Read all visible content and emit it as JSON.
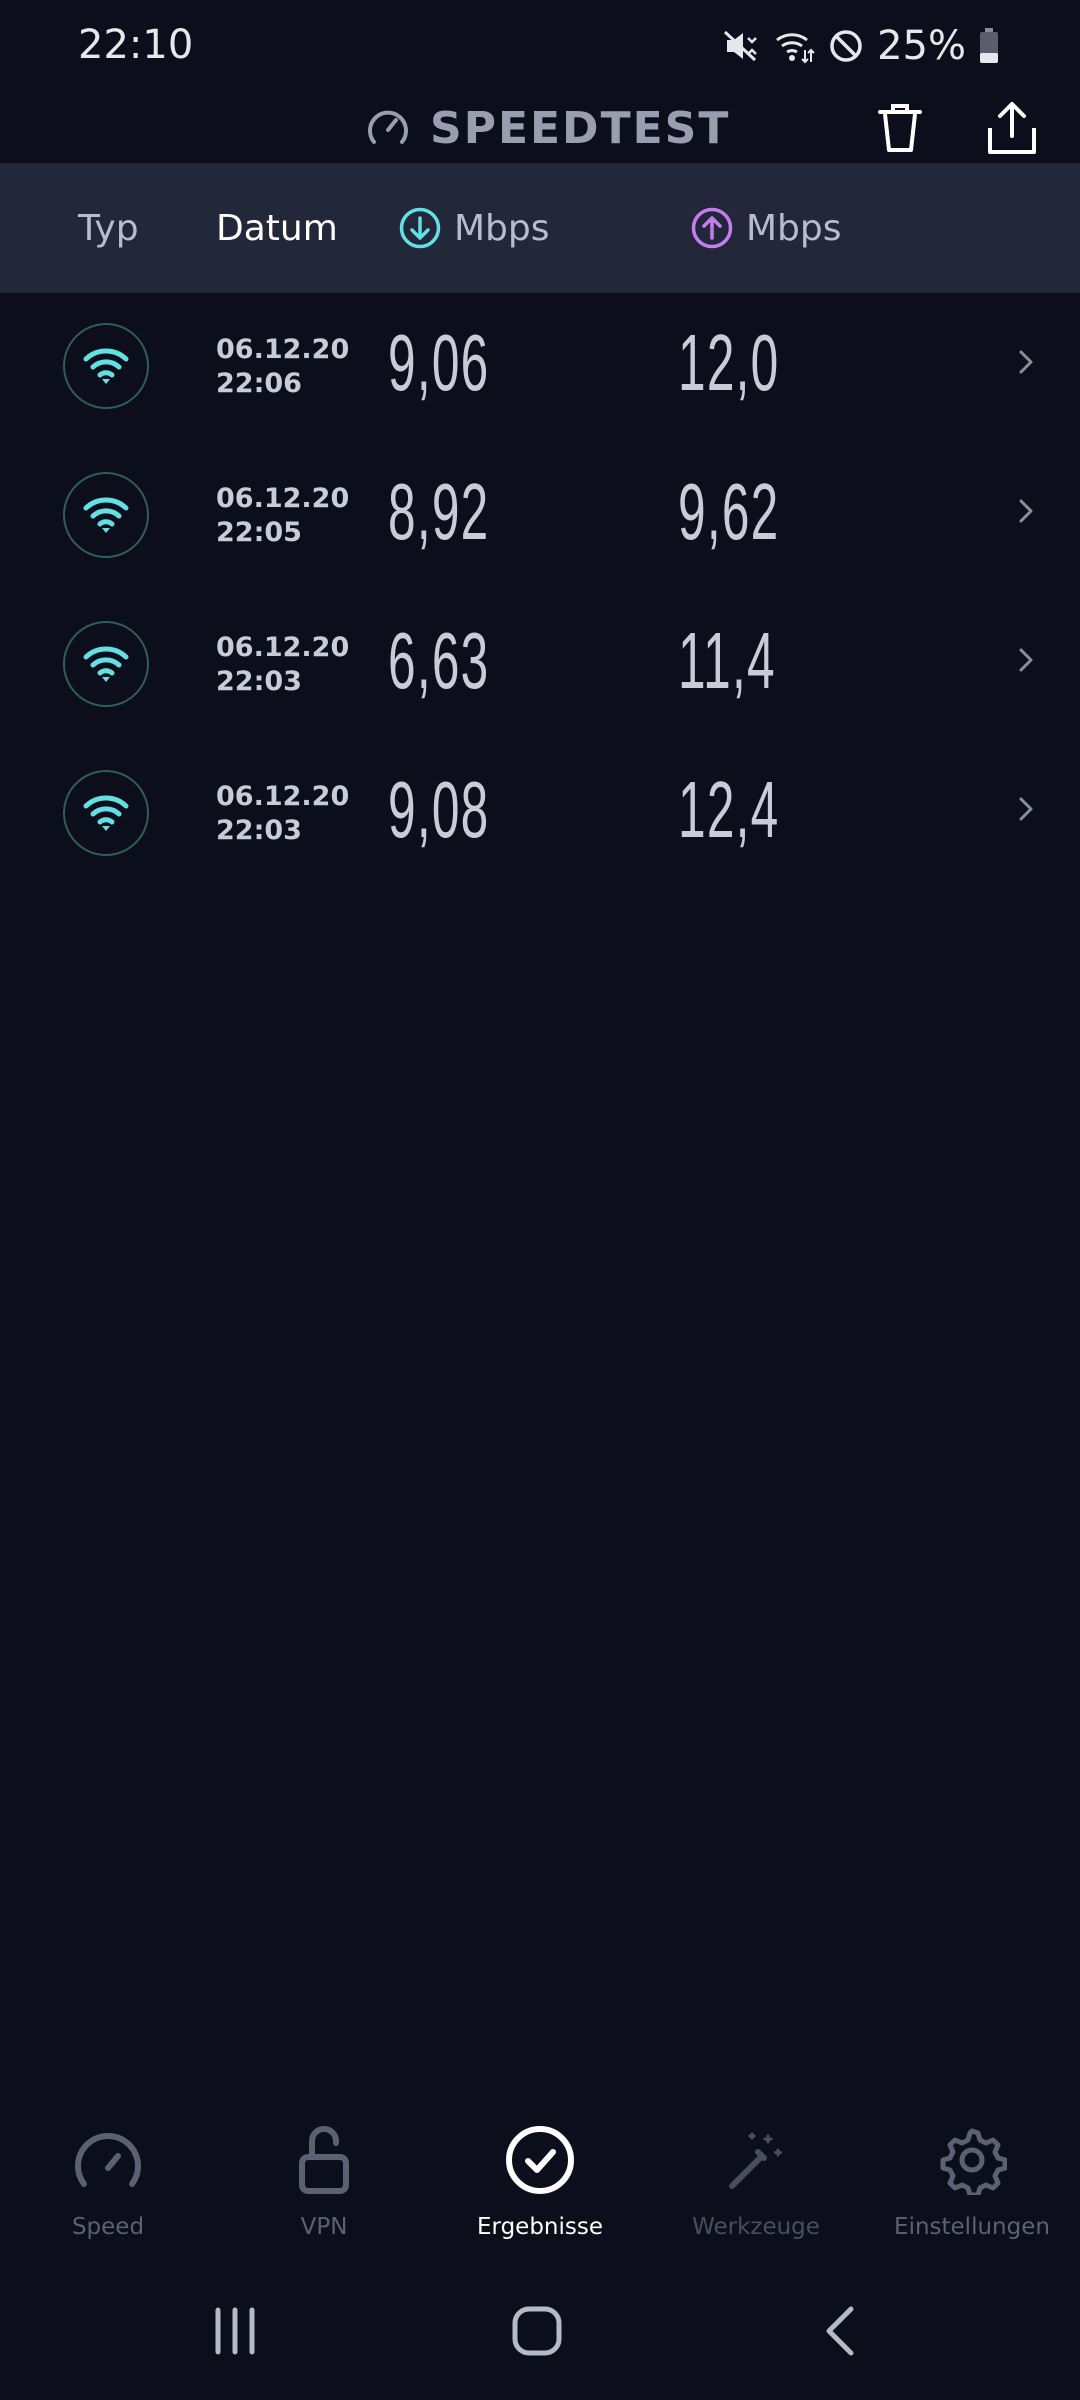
{
  "status": {
    "time": "22:10",
    "battery": "25%"
  },
  "app": {
    "title": "SPEEDTEST"
  },
  "header": {
    "type": "Typ",
    "date": "Datum",
    "download": "Mbps",
    "upload": "Mbps"
  },
  "results": [
    {
      "date": "06.12.20",
      "time": "22:06",
      "download": "9,06",
      "upload": "12,0",
      "connection_icon": "wifi-icon"
    },
    {
      "date": "06.12.20",
      "time": "22:05",
      "download": "8,92",
      "upload": "9,62",
      "connection_icon": "wifi-icon"
    },
    {
      "date": "06.12.20",
      "time": "22:03",
      "download": "6,63",
      "upload": "11,4",
      "connection_icon": "wifi-icon"
    },
    {
      "date": "06.12.20",
      "time": "22:03",
      "download": "9,08",
      "upload": "12,4",
      "connection_icon": "wifi-icon"
    }
  ],
  "nav": {
    "speed": "Speed",
    "vpn": "VPN",
    "results": "Ergebnisse",
    "tools": "Werkzeuge",
    "settings": "Einstellungen",
    "active": "results"
  },
  "colors": {
    "background": "#0c0e1b",
    "header": "#22273a",
    "download_accent": "#63e0e2",
    "upload_accent": "#c77df0",
    "wifi": "#63e0e2"
  }
}
